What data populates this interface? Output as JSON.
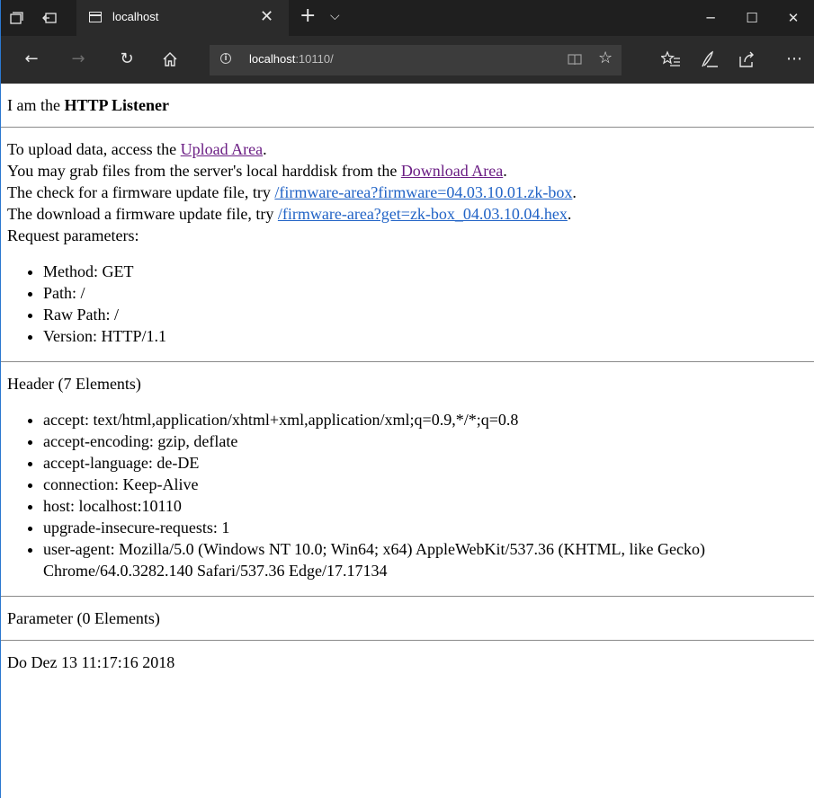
{
  "browser": {
    "tab_title": "localhost",
    "address_host": "localhost",
    "address_port": ":10110/"
  },
  "page": {
    "intro_prefix": "I am the ",
    "intro_bold": "HTTP Listener",
    "upload_prefix": "To upload data, access the ",
    "upload_link": "Upload Area",
    "upload_suffix": ".",
    "download_prefix": "You may grab files from the server's local harddisk from the ",
    "download_link": "Download Area",
    "download_suffix": ".",
    "fw_check_prefix": "The check for a firmware update file, try ",
    "fw_check_link": "/firmware-area?firmware=04.03.10.01.zk-box",
    "fw_check_suffix": ".",
    "fw_get_prefix": "The download a firmware update file, try ",
    "fw_get_link": "/firmware-area?get=zk-box_04.03.10.04.hex",
    "fw_get_suffix": ".",
    "request_label": "Request parameters:",
    "request_params": [
      "Method: GET",
      "Path: /",
      "Raw Path: /",
      "Version: HTTP/1.1"
    ],
    "header_title": "Header (7 Elements)",
    "headers": [
      "accept: text/html,application/xhtml+xml,application/xml;q=0.9,*/*;q=0.8",
      "accept-encoding: gzip, deflate",
      "accept-language: de-DE",
      "connection: Keep-Alive",
      "host: localhost:10110",
      "upgrade-insecure-requests: 1",
      "user-agent: Mozilla/5.0 (Windows NT 10.0; Win64; x64) AppleWebKit/537.36 (KHTML, like Gecko) Chrome/64.0.3282.140 Safari/537.36 Edge/17.17134"
    ],
    "parameter_title": "Parameter (0 Elements)",
    "timestamp": "Do Dez 13 11:17:16 2018"
  }
}
